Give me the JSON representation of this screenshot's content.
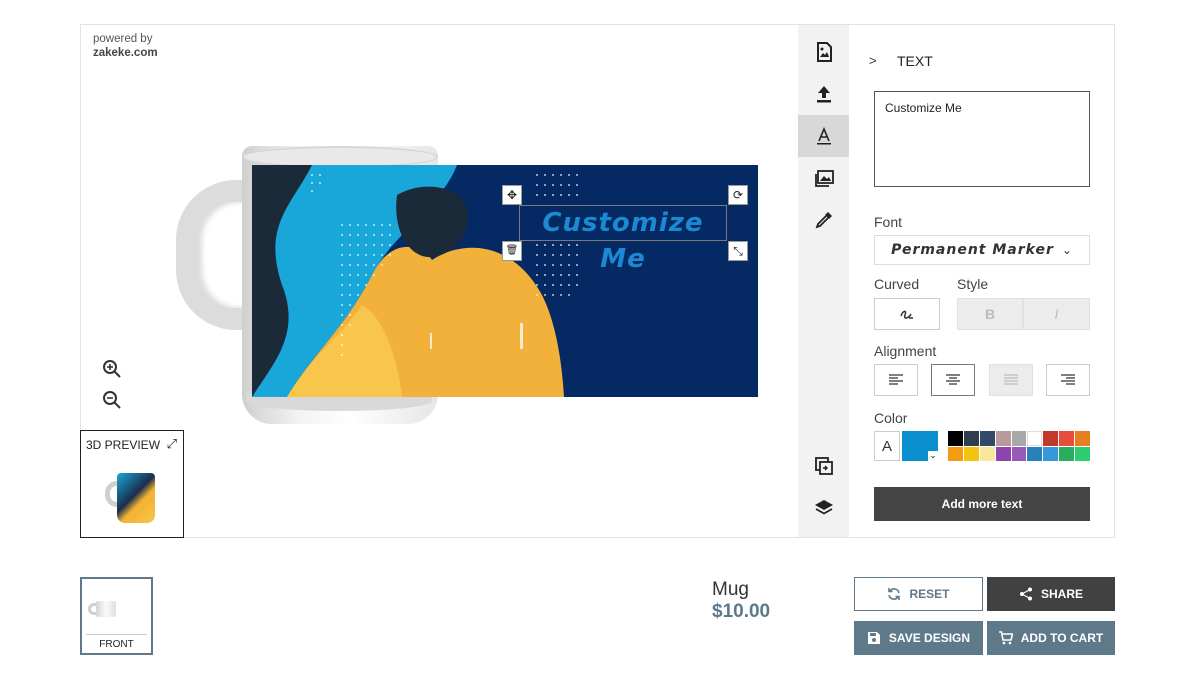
{
  "powered_by": {
    "line1": "powered by",
    "line2": "zakeke.com"
  },
  "canvas": {
    "customize_text": "Customize Me",
    "handles": {
      "move": "✥",
      "rotate": "⟳",
      "delete": "🗑",
      "resize": "⤡"
    }
  },
  "zoom": {
    "in_icon": "zoom-in-icon",
    "out_icon": "zoom-out-icon"
  },
  "preview3d": {
    "label": "3D PREVIEW",
    "expand_icon": "⤢"
  },
  "toolbar": {
    "items": [
      {
        "name": "image-icon"
      },
      {
        "name": "upload-icon"
      },
      {
        "name": "text-icon"
      },
      {
        "name": "gallery-icon"
      },
      {
        "name": "eyedropper-icon"
      },
      {
        "name": "copy-icon"
      },
      {
        "name": "layers-icon"
      }
    ]
  },
  "panel": {
    "chevron": ">",
    "title": "TEXT",
    "text_value": "Customize Me",
    "font_label": "Font",
    "font_value": "Permanent Marker",
    "curved_label": "Curved",
    "style_label": "Style",
    "bold_label": "B",
    "italic_label": "I",
    "alignment_label": "Alignment",
    "color_label": "Color",
    "color_letter": "A",
    "selected_color": "#0a8fce",
    "palette": [
      "#000000",
      "#2f3d4f",
      "#324a6a",
      "#b89a9a",
      "#a8a8a8",
      "#ffffff",
      "#c0392b",
      "#e74c3c",
      "#e67e22",
      "#f39c12",
      "#f1c40f",
      "#f7e79a",
      "#8e44ad",
      "#9b59b6",
      "#2980b9",
      "#3498db",
      "#27ae60",
      "#2ecc71"
    ],
    "add_more_label": "Add more text"
  },
  "thumbnail": {
    "label": "FRONT"
  },
  "product": {
    "name": "Mug",
    "price": "$10.00"
  },
  "actions": {
    "reset": "RESET",
    "share": "SHARE",
    "save": "SAVE DESIGN",
    "cart": "ADD TO CART"
  }
}
